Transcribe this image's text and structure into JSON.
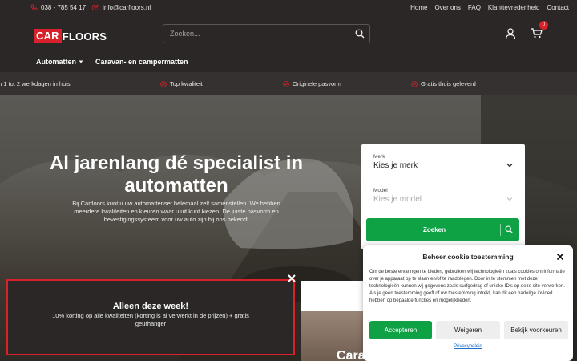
{
  "topbar": {
    "phone": "038 - 785 54 17",
    "email": "info@carfloors.nl",
    "links": [
      "Home",
      "Over ons",
      "FAQ",
      "Klanttevredenheid",
      "Contact"
    ]
  },
  "header": {
    "logo_part1": "CAR",
    "logo_part2": "FLOORS",
    "search_placeholder": "Zoeken...",
    "cart_count": "0"
  },
  "nav": {
    "item1": "Automatten",
    "item2": "Caravan- en campermatten"
  },
  "usp": [
    "n 1 tot 2 werkdagen in huis",
    "Top kwaliteit",
    "Originele pasvorm",
    "Gratis thuis geleverd"
  ],
  "hero": {
    "title": "Al jarenlang dé specialist in automatten",
    "text": "Bij Carfloors kunt u uw automattenset helemaal zelf samenstellen. We hebben meerdere kwaliteiten en kleuren waar u uit kunt kiezen. De juiste pasvorm en bevestigingssysteem voor uw auto zijn bij ons bekend!"
  },
  "filter": {
    "merk_label": "Merk",
    "merk_value": "Kies je merk",
    "model_label": "Model",
    "model_value": "Kies je model",
    "button": "Zoeken"
  },
  "promo": {
    "title": "Alleen deze week!",
    "text": "10% korting op alle kwaliteiten (korting is al verwerkt in de prijzen) + gratis geurhanger"
  },
  "section_heading": "Caravan- en campermatten",
  "cookie": {
    "title": "Beheer cookie toestemming",
    "text": "Om de beste ervaringen te bieden, gebruiken wij technologieën zoals cookies om informatie over je apparaat op te slaan en/of te raadplegen. Door in te stemmen met deze technologieën kunnen wij gegevens zoals surfgedrag of unieke ID's op deze site verwerken. Als je geen toestemming geeft of uw toestemming intrekt, kan dit een nadelige invloed hebben op bepaalde functies en mogelijkheden.",
    "accept": "Accepteren",
    "deny": "Weigeren",
    "prefs": "Bekijk voorkeuren",
    "privacy": "Privacybeleid"
  },
  "colors": {
    "brand_red": "#d7222a",
    "accent_green": "#0ea244",
    "dark_bg": "#2b2726"
  }
}
